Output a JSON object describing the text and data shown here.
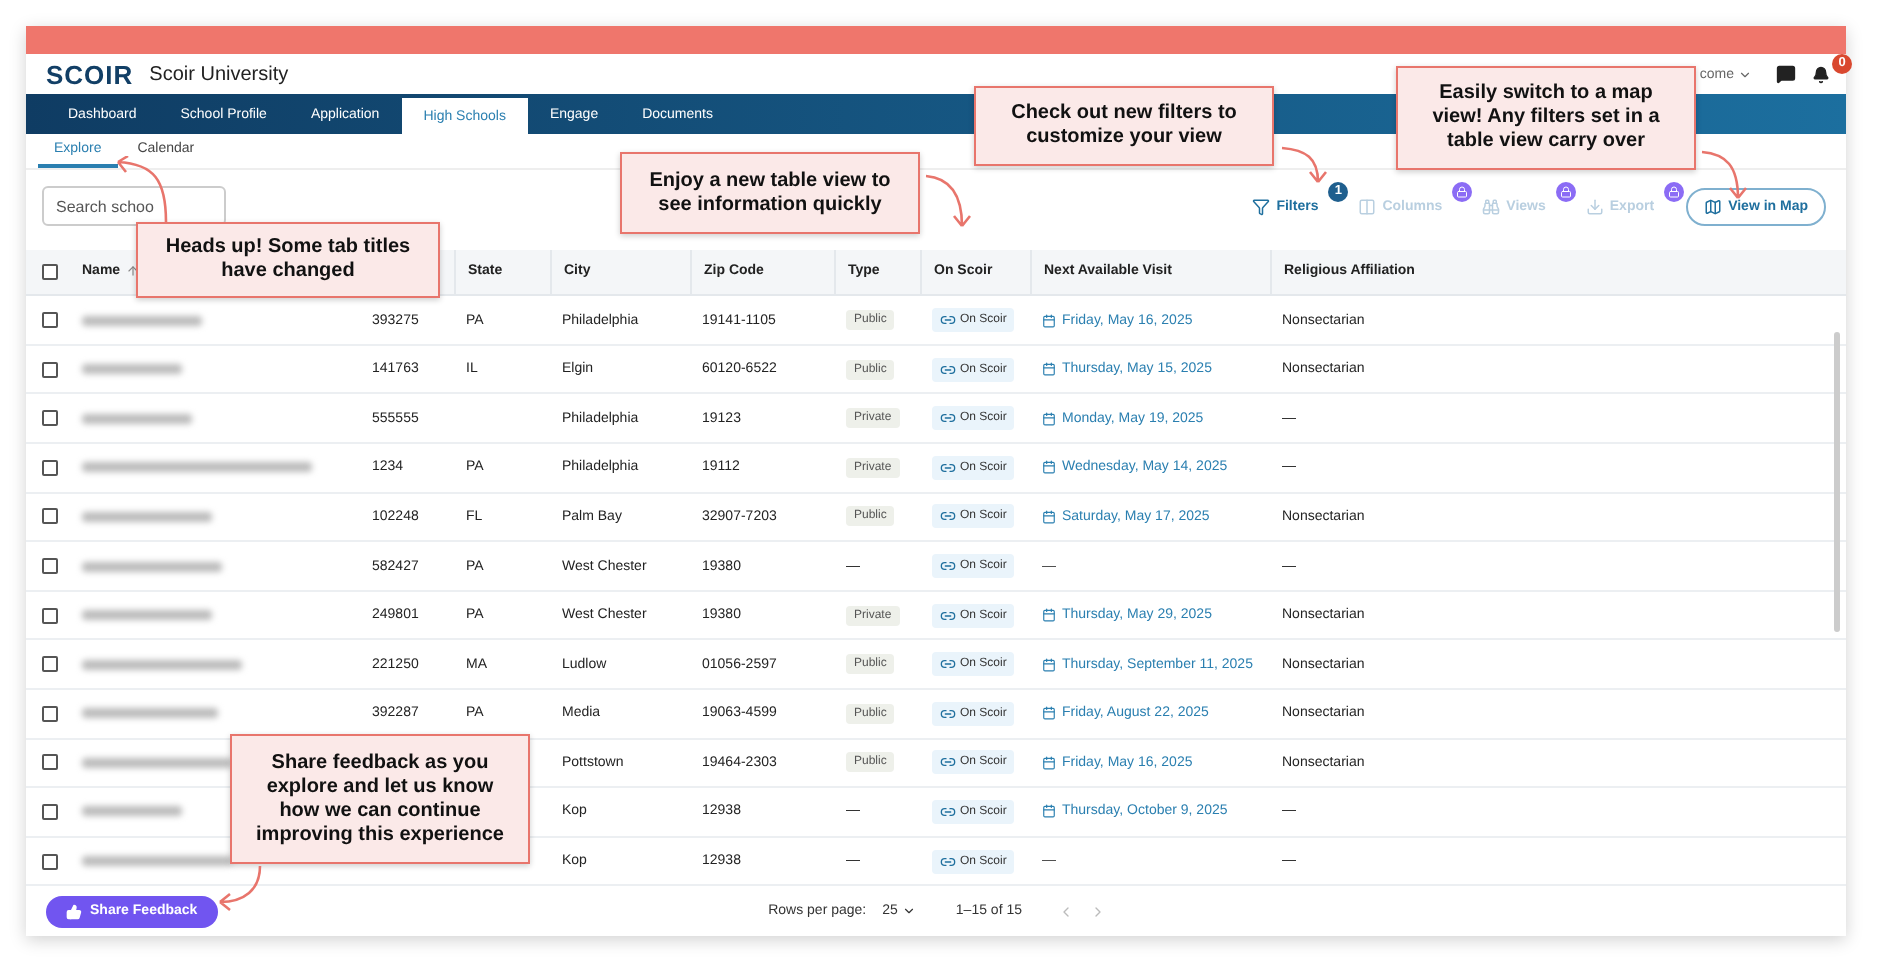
{
  "header": {
    "logo": "SCOIR",
    "title": "Scoir University",
    "user": "come",
    "notifications": "0"
  },
  "nav": [
    {
      "label": "Dashboard",
      "selected": false
    },
    {
      "label": "School Profile",
      "selected": false
    },
    {
      "label": "Application",
      "selected": false
    },
    {
      "label": "High Schools",
      "selected": true
    },
    {
      "label": "Engage",
      "selected": false
    },
    {
      "label": "Documents",
      "selected": false
    }
  ],
  "subtabs": [
    {
      "label": "Explore",
      "selected": true
    },
    {
      "label": "Calendar",
      "selected": false
    }
  ],
  "search": {
    "placeholder": "Search schoo"
  },
  "toolbar": [
    {
      "label": "Filters",
      "kind": "filter",
      "badge": "1",
      "locked": false
    },
    {
      "label": "Columns",
      "kind": "columns",
      "locked": true
    },
    {
      "label": "Views",
      "kind": "views",
      "locked": true
    },
    {
      "label": "Export",
      "kind": "export",
      "locked": true
    },
    {
      "label": "View in Map",
      "kind": "map",
      "locked": false
    }
  ],
  "table": {
    "all_checked": false,
    "columns": [
      "Name",
      "",
      "State",
      "City",
      "Zip Code",
      "Type",
      "On Scoir",
      "Next Available Visit",
      "Religious Affiliation"
    ],
    "rows": [
      {
        "id": "393275",
        "state": "PA",
        "city": "Philadelphia",
        "zip": "19141-1105",
        "type": {
          "label": "Public",
          "chip": true
        },
        "on_scoir": "On Scoir",
        "visit": {
          "text": "Friday, May 16, 2025",
          "scheduled": true
        },
        "religion": "Nonsectarian",
        "checked": false
      },
      {
        "id": "141763",
        "state": "IL",
        "city": "Elgin",
        "zip": "60120-6522",
        "type": {
          "label": "Public",
          "chip": true
        },
        "on_scoir": "On Scoir",
        "visit": {
          "text": "Thursday, May 15, 2025",
          "scheduled": true
        },
        "religion": "Nonsectarian",
        "checked": false
      },
      {
        "id": "555555",
        "state": "",
        "city": "Philadelphia",
        "zip": "19123",
        "type": {
          "label": "Private",
          "chip": true
        },
        "on_scoir": "On Scoir",
        "visit": {
          "text": "Monday, May 19, 2025",
          "scheduled": true
        },
        "religion": "—",
        "checked": false
      },
      {
        "id": "1234",
        "state": "PA",
        "city": "Philadelphia",
        "zip": "19112",
        "type": {
          "label": "Private",
          "chip": true
        },
        "on_scoir": "On Scoir",
        "visit": {
          "text": "Wednesday, May 14, 2025",
          "scheduled": true
        },
        "religion": "—",
        "checked": false
      },
      {
        "id": "102248",
        "state": "FL",
        "city": "Palm Bay",
        "zip": "32907-7203",
        "type": {
          "label": "Public",
          "chip": true
        },
        "on_scoir": "On Scoir",
        "visit": {
          "text": "Saturday, May 17, 2025",
          "scheduled": true
        },
        "religion": "Nonsectarian",
        "checked": false
      },
      {
        "id": "582427",
        "state": "PA",
        "city": "West Chester",
        "zip": "19380",
        "type": {
          "label": "—",
          "chip": false
        },
        "on_scoir": "On Scoir",
        "visit": {
          "text": "—",
          "scheduled": false
        },
        "religion": "—",
        "checked": false
      },
      {
        "id": "249801",
        "state": "PA",
        "city": "West Chester",
        "zip": "19380",
        "type": {
          "label": "Private",
          "chip": true
        },
        "on_scoir": "On Scoir",
        "visit": {
          "text": "Thursday, May 29, 2025",
          "scheduled": true
        },
        "religion": "Nonsectarian",
        "checked": false
      },
      {
        "id": "221250",
        "state": "MA",
        "city": "Ludlow",
        "zip": "01056-2597",
        "type": {
          "label": "Public",
          "chip": true
        },
        "on_scoir": "On Scoir",
        "visit": {
          "text": "Thursday, September 11, 2025",
          "scheduled": true
        },
        "religion": "Nonsectarian",
        "checked": false
      },
      {
        "id": "392287",
        "state": "PA",
        "city": "Media",
        "zip": "19063-4599",
        "type": {
          "label": "Public",
          "chip": true
        },
        "on_scoir": "On Scoir",
        "visit": {
          "text": "Friday, August 22, 2025",
          "scheduled": true
        },
        "religion": "Nonsectarian",
        "checked": false
      },
      {
        "id": "",
        "state": "",
        "city": "Pottstown",
        "zip": "19464-2303",
        "type": {
          "label": "Public",
          "chip": true
        },
        "on_scoir": "On Scoir",
        "visit": {
          "text": "Friday, May 16, 2025",
          "scheduled": true
        },
        "religion": "Nonsectarian",
        "checked": false
      },
      {
        "id": "",
        "state": "",
        "city": "Kop",
        "zip": "12938",
        "type": {
          "label": "—",
          "chip": false
        },
        "on_scoir": "On Scoir",
        "visit": {
          "text": "Thursday, October 9, 2025",
          "scheduled": true
        },
        "religion": "—",
        "checked": false
      },
      {
        "id": "",
        "state": "",
        "city": "Kop",
        "zip": "12938",
        "type": {
          "label": "—",
          "chip": false
        },
        "on_scoir": "On Scoir",
        "visit": {
          "text": "—",
          "scheduled": false
        },
        "religion": "—",
        "checked": false
      }
    ]
  },
  "footer": {
    "feedback": "Share Feedback",
    "rows_label": "Rows per page:",
    "rows_value": "25",
    "range": "1–15 of 15"
  },
  "callouts": [
    {
      "text": "Heads up! Some tab titles have changed",
      "kind": "tabs"
    },
    {
      "text": "Enjoy a new table view to see information quickly",
      "kind": "table"
    },
    {
      "text": "Check out new filters to customize your view",
      "kind": "filters"
    },
    {
      "text": "Easily switch to a map view! Any filters set in a table view carry over",
      "kind": "map"
    },
    {
      "text": "Share feedback as you explore and let us know how we can continue improving this experience",
      "kind": "feedback"
    }
  ]
}
